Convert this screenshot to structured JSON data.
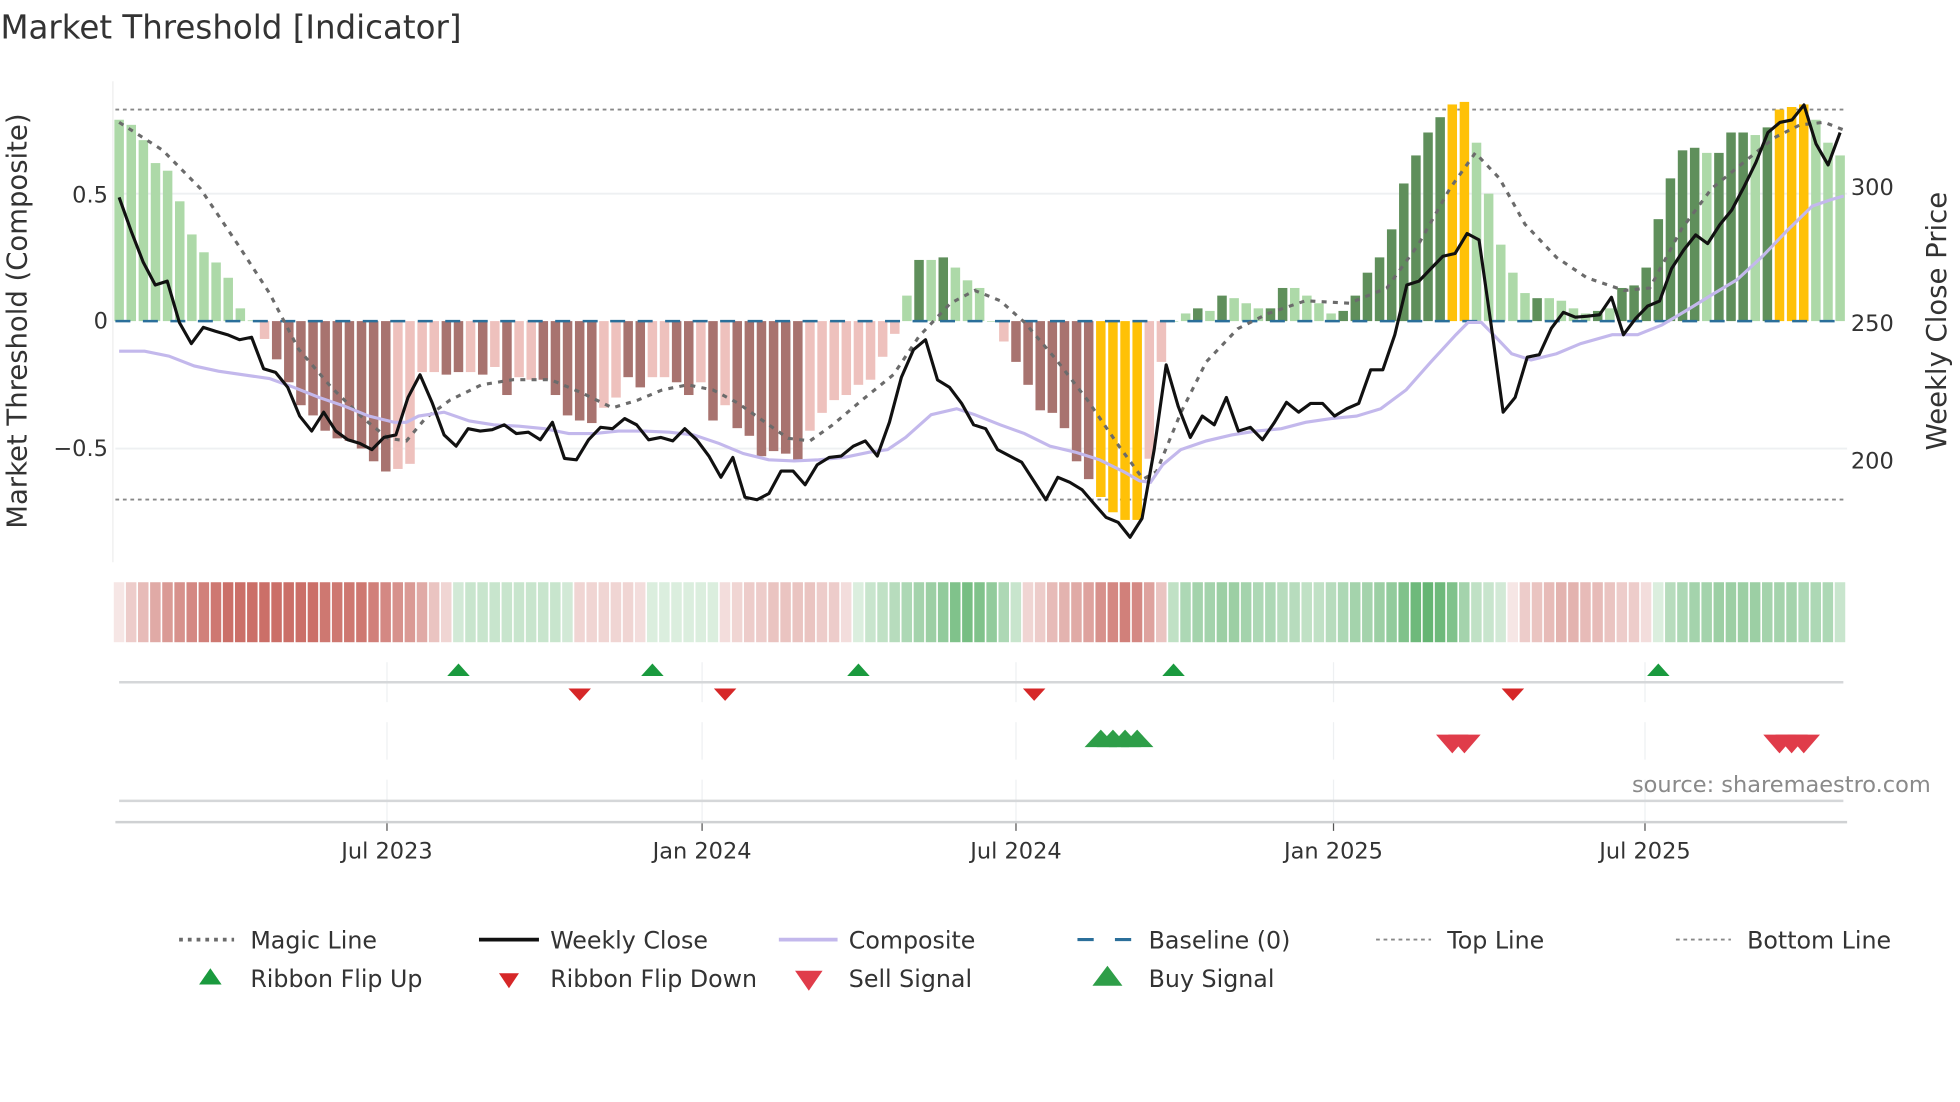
{
  "title": "Market Threshold [Indicator]",
  "source": "source: sharemaestro.com",
  "colors": {
    "bar_pos_dark": "#5f8f5b",
    "bar_pos_light": "#add9a8",
    "bar_neg_dark": "#a8736f",
    "bar_neg_light": "#eec1bd",
    "bar_extreme": "#ffc107",
    "ribbon_green": "#4aa85a",
    "ribbon_red": "#c2564e",
    "weekly_close": "#111111",
    "composite": "#c3b8ec",
    "magic": "#6b6b6b",
    "baseline": "#2b6f9a",
    "threshold": "#888888",
    "flip_up": "#1a9a3e",
    "flip_down": "#d62728",
    "sell": "#e03c4a",
    "buy": "#2e9e48"
  },
  "chart_data": {
    "type": "bar",
    "title": "Market Threshold [Indicator]",
    "ylabel": "Market Threshold (Composite)",
    "ylabel_right": "Weekly Close Price",
    "ylim": [
      -0.95,
      0.95
    ],
    "ylim_right": [
      165,
      335
    ],
    "y_ticks": [
      {
        "value": 0.5,
        "label": "0.5"
      },
      {
        "value": 0,
        "label": "0"
      },
      {
        "value": -0.5,
        "label": "−0.5"
      }
    ],
    "y_ticks_right": [
      {
        "value": 300,
        "label": "300"
      },
      {
        "value": 250,
        "label": "250"
      },
      {
        "value": 200,
        "label": "200"
      }
    ],
    "x_unit": "week index",
    "x_ticks": [
      {
        "label": "Jul 2023",
        "week": 22.1
      },
      {
        "label": "Jan 2024",
        "week": 48.1
      },
      {
        "label": "Jul 2024",
        "week": 74.0
      },
      {
        "label": "Jan 2025",
        "week": 100.2
      },
      {
        "label": "Jul 2025",
        "week": 125.9
      }
    ],
    "top_line": 0.83,
    "bottom_line": -0.7,
    "baseline": 0,
    "composite_bars": [
      0.79,
      0.77,
      0.71,
      0.62,
      0.59,
      0.47,
      0.34,
      0.27,
      0.23,
      0.17,
      0.05,
      0.003,
      -0.07,
      -0.15,
      -0.24,
      -0.33,
      -0.37,
      -0.43,
      -0.46,
      -0.47,
      -0.5,
      -0.55,
      -0.59,
      -0.58,
      -0.56,
      -0.2,
      -0.2,
      -0.21,
      -0.2,
      -0.2,
      -0.21,
      -0.18,
      -0.29,
      -0.22,
      -0.23,
      -0.23,
      -0.29,
      -0.37,
      -0.39,
      -0.4,
      -0.34,
      -0.3,
      -0.22,
      -0.26,
      -0.22,
      -0.22,
      -0.24,
      -0.29,
      -0.24,
      -0.39,
      -0.33,
      -0.42,
      -0.45,
      -0.53,
      -0.51,
      -0.52,
      -0.55,
      -0.43,
      -0.36,
      -0.31,
      -0.29,
      -0.25,
      -0.23,
      -0.14,
      -0.05,
      0.1,
      0.24,
      0.24,
      0.25,
      0.21,
      0.16,
      0.13,
      0.0,
      -0.08,
      -0.16,
      -0.25,
      -0.35,
      -0.36,
      -0.42,
      -0.55,
      -0.62,
      -0.69,
      -0.75,
      -0.78,
      -0.78,
      -0.54,
      -0.16,
      0.0,
      0.03,
      0.05,
      0.04,
      0.1,
      0.09,
      0.07,
      0.05,
      0.05,
      0.13,
      0.13,
      0.1,
      0.07,
      0.03,
      0.04,
      0.1,
      0.19,
      0.25,
      0.36,
      0.54,
      0.65,
      0.74,
      0.8,
      0.85,
      0.86,
      0.7,
      0.5,
      0.3,
      0.19,
      0.11,
      0.09,
      0.09,
      0.08,
      0.05,
      0.03,
      0.04,
      0.05,
      0.13,
      0.14,
      0.21,
      0.4,
      0.56,
      0.67,
      0.68,
      0.66,
      0.66,
      0.74,
      0.74,
      0.73,
      0.76,
      0.83,
      0.84,
      0.85,
      0.79,
      0.7,
      0.65
    ],
    "bar_shade": "lllllllllllllddddddddddlllLDDLDLDLLDDDDDLLDDLLDDLDLDDDDDDLLLLLLLLLDLDLLLLLDDDDDDDGGGGLLLLDLDLLLDDLLLLDDDDDDDDDGGLLLLLDLLLLDLDDDDDDDLDDDLDGGGLLL",
    "weekly_close": [
      295.2,
      282.9,
      271.5,
      263.2,
      264.6,
      249.5,
      241.8,
      247.7,
      246.3,
      245.0,
      243.2,
      244.1,
      232.6,
      231.3,
      225.8,
      215.3,
      209.8,
      216.7,
      209.8,
      206.6,
      205.3,
      203.0,
      207.5,
      208.4,
      222.1,
      230.4,
      220.3,
      208.4,
      204.3,
      210.7,
      209.8,
      210.3,
      212.1,
      208.9,
      209.4,
      206.6,
      213.0,
      199.8,
      199.3,
      206.6,
      211.2,
      210.7,
      214.4,
      212.1,
      206.6,
      207.5,
      206.2,
      210.7,
      206.6,
      200.7,
      192.9,
      200.2,
      185.6,
      184.7,
      187.0,
      195.2,
      195.2,
      190.2,
      197.5,
      200.2,
      200.7,
      204.3,
      206.2,
      200.7,
      213.0,
      229.5,
      239.5,
      243.2,
      228.5,
      225.8,
      219.9,
      212.1,
      210.7,
      203.0,
      200.7,
      198.4,
      191.6,
      184.7,
      192.9,
      191.1,
      188.4,
      183.3,
      178.3,
      176.5,
      171.0,
      177.9,
      203.0,
      234.0,
      218.9,
      207.5,
      215.3,
      212.1,
      222.1,
      209.8,
      211.2,
      206.6,
      213.0,
      220.3,
      216.7,
      219.9,
      219.9,
      215.3,
      218.0,
      219.9,
      232.2,
      232.2,
      245.0,
      263.2,
      264.6,
      269.2,
      273.7,
      274.7,
      282.0,
      279.7,
      248.6,
      216.7,
      222.1,
      236.8,
      237.7,
      247.3,
      253.2,
      251.4,
      251.8,
      252.3,
      258.7,
      245.0,
      250.9,
      255.5,
      257.3,
      269.2,
      276.0,
      281.5,
      278.3,
      285.2,
      290.6,
      298.9,
      308.0,
      318.9,
      322.6,
      323.5,
      329.0,
      314.8,
      307.1,
      318.9
    ],
    "composite_line": [
      [
        0,
        239.0
      ],
      [
        2.1,
        239.0
      ],
      [
        4.1,
        237.2
      ],
      [
        6.2,
        233.6
      ],
      [
        8.2,
        231.7
      ],
      [
        12.4,
        229.0
      ],
      [
        14.4,
        225.8
      ],
      [
        16.5,
        222.1
      ],
      [
        18.6,
        218.9
      ],
      [
        20.6,
        215.3
      ],
      [
        22.7,
        213.0
      ],
      [
        23.7,
        213.0
      ],
      [
        24.7,
        215.3
      ],
      [
        26.8,
        216.7
      ],
      [
        28.9,
        213.5
      ],
      [
        30.9,
        212.1
      ],
      [
        33.0,
        211.6
      ],
      [
        35.1,
        210.7
      ],
      [
        37.1,
        208.9
      ],
      [
        39.2,
        208.9
      ],
      [
        41.2,
        209.8
      ],
      [
        43.3,
        209.8
      ],
      [
        45.4,
        209.4
      ],
      [
        47.4,
        208.4
      ],
      [
        49.5,
        205.3
      ],
      [
        51.5,
        201.6
      ],
      [
        53.6,
        199.3
      ],
      [
        55.7,
        198.9
      ],
      [
        57.7,
        199.3
      ],
      [
        59.8,
        200.2
      ],
      [
        61.9,
        202.1
      ],
      [
        63.4,
        203.0
      ],
      [
        64.9,
        207.5
      ],
      [
        67.0,
        215.8
      ],
      [
        69.1,
        218.0
      ],
      [
        70.6,
        215.8
      ],
      [
        72.7,
        212.1
      ],
      [
        74.7,
        208.9
      ],
      [
        76.8,
        204.3
      ],
      [
        78.9,
        202.1
      ],
      [
        80.9,
        199.3
      ],
      [
        83.0,
        194.7
      ],
      [
        84.2,
        191.6
      ],
      [
        85.1,
        191.1
      ],
      [
        86.1,
        197.5
      ],
      [
        87.6,
        203.0
      ],
      [
        89.7,
        206.2
      ],
      [
        91.8,
        208.4
      ],
      [
        93.8,
        209.8
      ],
      [
        95.9,
        210.7
      ],
      [
        97.9,
        213.0
      ],
      [
        100.0,
        214.4
      ],
      [
        102.1,
        215.3
      ],
      [
        104.1,
        218.0
      ],
      [
        106.2,
        224.9
      ],
      [
        108.2,
        234.9
      ],
      [
        110.3,
        245.0
      ],
      [
        111.3,
        249.5
      ],
      [
        112.4,
        249.5
      ],
      [
        113.4,
        245.0
      ],
      [
        114.9,
        238.1
      ],
      [
        116.5,
        235.8
      ],
      [
        118.6,
        238.1
      ],
      [
        120.6,
        241.8
      ],
      [
        123.2,
        245.0
      ],
      [
        125.3,
        245.0
      ],
      [
        127.3,
        248.6
      ],
      [
        129.4,
        254.1
      ],
      [
        131.4,
        259.6
      ],
      [
        133.5,
        265.1
      ],
      [
        135.6,
        273.7
      ],
      [
        137.6,
        282.9
      ],
      [
        139.7,
        292.0
      ],
      [
        141.2,
        294.3
      ],
      [
        142.3,
        295.7
      ]
    ],
    "magic_line": [
      [
        0,
        0.78
      ],
      [
        3.6,
        0.67
      ],
      [
        6.7,
        0.52
      ],
      [
        9.8,
        0.3
      ],
      [
        12.4,
        0.11
      ],
      [
        14.8,
        -0.11
      ],
      [
        17.5,
        -0.26
      ],
      [
        20.1,
        -0.38
      ],
      [
        22.2,
        -0.46
      ],
      [
        23.7,
        -0.47
      ],
      [
        25.3,
        -0.38
      ],
      [
        27.3,
        -0.31
      ],
      [
        29.9,
        -0.25
      ],
      [
        32.5,
        -0.23
      ],
      [
        35.6,
        -0.23
      ],
      [
        38.1,
        -0.28
      ],
      [
        40.7,
        -0.34
      ],
      [
        42.8,
        -0.31
      ],
      [
        44.8,
        -0.27
      ],
      [
        46.9,
        -0.25
      ],
      [
        49.0,
        -0.27
      ],
      [
        51.0,
        -0.32
      ],
      [
        53.1,
        -0.39
      ],
      [
        55.2,
        -0.46
      ],
      [
        57.0,
        -0.47
      ],
      [
        58.8,
        -0.41
      ],
      [
        61.3,
        -0.31
      ],
      [
        63.9,
        -0.21
      ],
      [
        66.0,
        -0.06
      ],
      [
        68.6,
        0.07
      ],
      [
        70.6,
        0.12
      ],
      [
        72.7,
        0.08
      ],
      [
        74.7,
        -0.005
      ],
      [
        77.3,
        -0.15
      ],
      [
        79.9,
        -0.31
      ],
      [
        82.5,
        -0.49
      ],
      [
        84.5,
        -0.62
      ],
      [
        85.6,
        -0.59
      ],
      [
        87.6,
        -0.36
      ],
      [
        89.7,
        -0.16
      ],
      [
        92.3,
        -0.03
      ],
      [
        94.8,
        0.03
      ],
      [
        97.9,
        0.08
      ],
      [
        101.5,
        0.07
      ],
      [
        104.6,
        0.13
      ],
      [
        107.2,
        0.3
      ],
      [
        109.8,
        0.52
      ],
      [
        111.9,
        0.66
      ],
      [
        113.9,
        0.56
      ],
      [
        116.0,
        0.38
      ],
      [
        118.6,
        0.25
      ],
      [
        121.1,
        0.17
      ],
      [
        124.2,
        0.12
      ],
      [
        126.3,
        0.13
      ],
      [
        128.9,
        0.36
      ],
      [
        131.4,
        0.52
      ],
      [
        134.5,
        0.64
      ],
      [
        136.6,
        0.72
      ],
      [
        138.7,
        0.77
      ],
      [
        140.7,
        0.78
      ],
      [
        142.3,
        0.75
      ]
    ],
    "ribbon": [
      -0.15,
      -0.3,
      -0.4,
      -0.5,
      -0.6,
      -0.65,
      -0.7,
      -0.75,
      -0.8,
      -0.85,
      -0.85,
      -0.85,
      -0.85,
      -0.85,
      -0.85,
      -0.85,
      -0.85,
      -0.8,
      -0.8,
      -0.8,
      -0.8,
      -0.75,
      -0.7,
      -0.65,
      -0.6,
      -0.5,
      -0.35,
      -0.25,
      0.25,
      0.3,
      0.3,
      0.3,
      0.3,
      0.3,
      0.3,
      0.3,
      0.3,
      0.25,
      -0.25,
      -0.25,
      -0.25,
      -0.25,
      -0.25,
      -0.2,
      0.2,
      0.2,
      0.2,
      0.2,
      0.2,
      0.2,
      -0.2,
      -0.25,
      -0.3,
      -0.3,
      -0.35,
      -0.35,
      -0.35,
      -0.35,
      -0.3,
      -0.3,
      -0.2,
      0.2,
      0.3,
      0.35,
      0.4,
      0.45,
      0.5,
      0.55,
      0.6,
      0.7,
      0.75,
      0.7,
      0.6,
      0.45,
      0.3,
      -0.25,
      -0.3,
      -0.4,
      -0.45,
      -0.5,
      -0.55,
      -0.65,
      -0.7,
      -0.75,
      -0.7,
      -0.55,
      -0.35,
      0.35,
      0.45,
      0.5,
      0.5,
      0.55,
      0.55,
      0.5,
      0.45,
      0.45,
      0.4,
      0.4,
      0.35,
      0.35,
      0.4,
      0.45,
      0.5,
      0.5,
      0.55,
      0.6,
      0.7,
      0.8,
      0.85,
      0.8,
      0.7,
      0.5,
      0.35,
      0.3,
      0.25,
      -0.15,
      -0.3,
      -0.35,
      -0.4,
      -0.45,
      -0.45,
      -0.4,
      -0.4,
      -0.35,
      -0.3,
      -0.3,
      -0.2,
      0.2,
      0.4,
      0.45,
      0.5,
      0.5,
      0.55,
      0.55,
      0.55,
      0.55,
      0.5,
      0.5,
      0.5,
      0.45,
      0.45,
      0.45,
      0.3
    ],
    "ribbon_flip_up": [
      28,
      44,
      61,
      87,
      127
    ],
    "ribbon_flip_down": [
      38,
      50,
      75.5,
      115
    ],
    "buy_signals": [
      81,
      82,
      83,
      84
    ],
    "sell_signals": [
      110,
      111,
      137,
      138,
      139
    ],
    "legend_placement": "bottom",
    "legend": [
      {
        "label": "Magic Line"
      },
      {
        "label": "Weekly Close"
      },
      {
        "label": "Composite"
      },
      {
        "label": "Baseline (0)"
      },
      {
        "label": "Top Line"
      },
      {
        "label": "Bottom Line"
      },
      {
        "label": "Ribbon Flip Up"
      },
      {
        "label": "Ribbon Flip Down"
      },
      {
        "label": "Sell Signal"
      },
      {
        "label": "Buy Signal"
      }
    ]
  }
}
